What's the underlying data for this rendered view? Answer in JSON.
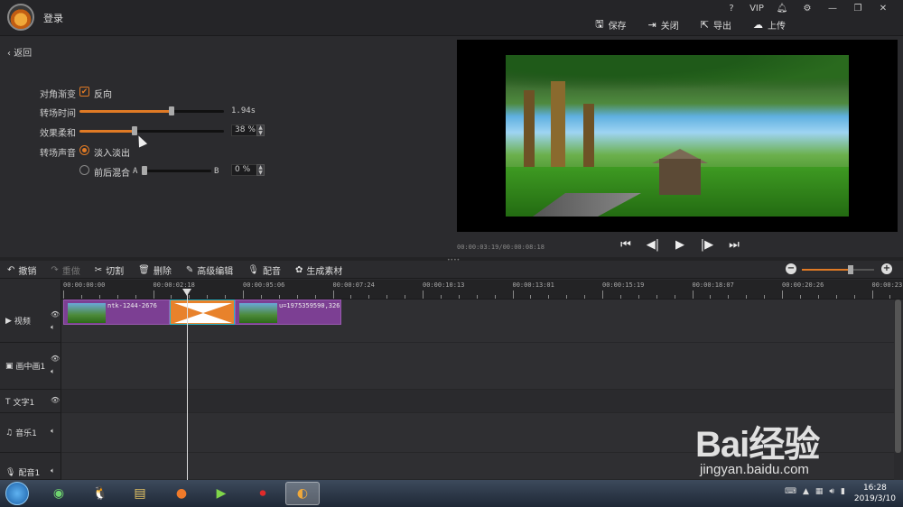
{
  "topbar": {
    "login": "登录",
    "actions": [
      {
        "icon": "save-icon",
        "label": "保存"
      },
      {
        "icon": "close-icon",
        "label": "关闭"
      },
      {
        "icon": "export-icon",
        "label": "导出"
      },
      {
        "icon": "upload-icon",
        "label": "上传"
      }
    ],
    "system_icons": [
      "help-icon",
      "vip-icon",
      "bell-icon",
      "gear-icon",
      "minimize-icon",
      "maximize-icon",
      "close-window-icon"
    ],
    "help_symbol": "?",
    "vip_label": "VIP"
  },
  "settings": {
    "back_label": "返回",
    "diagonal_label": "对角渐变",
    "reverse_label": "反向",
    "reverse_checked": true,
    "duration_label": "转场时间",
    "duration_value": "1.94s",
    "duration_fraction": 0.64,
    "softness_label": "效果柔和",
    "softness_value": "38 %",
    "softness_fraction": 0.38,
    "audio_label": "转场声音",
    "fade_label": "淡入淡出",
    "fade_selected": true,
    "mix_label": "前后混合",
    "mix_a": "A",
    "mix_b": "B",
    "mix_value": "0 %",
    "mix_fraction": 0.0
  },
  "preview": {
    "timecode": "00:00:03:19/00:00:08:18",
    "transport": [
      "skip-start-icon",
      "prev-frame-icon",
      "play-icon",
      "next-frame-icon",
      "skip-end-icon"
    ]
  },
  "toolbar": {
    "tools": [
      {
        "icon": "undo-icon",
        "label": "撤销",
        "enabled": true
      },
      {
        "icon": "redo-icon",
        "label": "重做",
        "enabled": false
      },
      {
        "icon": "cut-icon",
        "label": "切割",
        "enabled": true
      },
      {
        "icon": "delete-icon",
        "label": "删除",
        "enabled": true
      },
      {
        "icon": "edit-icon",
        "label": "高级编辑",
        "enabled": true
      },
      {
        "icon": "mic-icon",
        "label": "配音",
        "enabled": true
      },
      {
        "icon": "material-icon",
        "label": "生成素材",
        "enabled": true
      }
    ],
    "zoom_fraction": 0.68
  },
  "timeline": {
    "ticks": [
      "00:00:00:00",
      "00:00:02:18",
      "00:00:05:06",
      "00:00:07:24",
      "00:00:10:13",
      "00:00:13:01",
      "00:00:15:19",
      "00:00:18:07",
      "00:00:20:26",
      "00:00:23:"
    ],
    "tracks": [
      {
        "name": "视频",
        "icon": "video-track-icon"
      },
      {
        "name": "画中画1",
        "icon": "pip-track-icon"
      },
      {
        "name": "文字1",
        "icon": "text-track-icon"
      },
      {
        "name": "音乐1",
        "icon": "music-track-icon"
      },
      {
        "name": "配音1",
        "icon": "voice-track-icon"
      }
    ],
    "clips": [
      {
        "name": "ntk-1244-2676"
      },
      {
        "name": "u=1975359590,326"
      }
    ]
  },
  "taskbar": {
    "time": "16:28",
    "date": "2019/3/10"
  },
  "watermark": {
    "brand": "Bai经验",
    "url": "jingyan.baidu.com"
  }
}
